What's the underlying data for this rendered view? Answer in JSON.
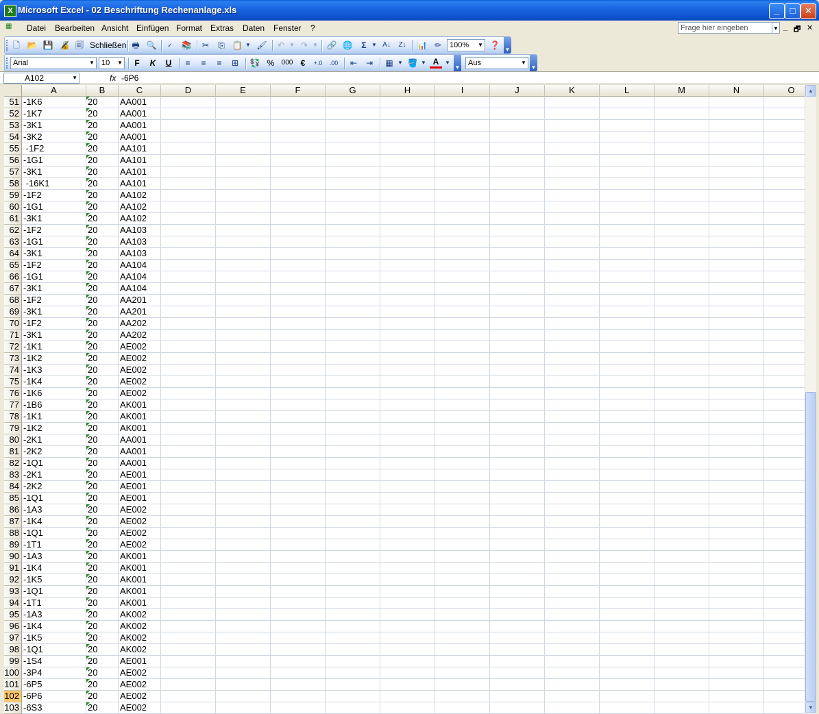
{
  "window": {
    "title": "Microsoft Excel - 02 Beschriftung Rechenanlage.xls",
    "app_icon_letter": "X",
    "minimize": "_",
    "maximize": "□",
    "close": "✕"
  },
  "menu": {
    "items": [
      "Datei",
      "Bearbeiten",
      "Ansicht",
      "Einfügen",
      "Format",
      "Extras",
      "Daten",
      "Fenster",
      "?"
    ],
    "help_placeholder": "Frage hier eingeben",
    "doc_minimize": "_",
    "doc_restore": "🗗",
    "doc_close": "✕"
  },
  "standard_toolbar": {
    "close_label": "Schließen",
    "zoom": "100%"
  },
  "format_toolbar": {
    "font": "Arial",
    "size": "10",
    "bold": "F",
    "italic": "K",
    "underline": "U",
    "percent": "%",
    "thousands": "000",
    "euro": "€",
    "style": "Aus"
  },
  "formula_bar": {
    "name_box": "A102",
    "fx": "fx",
    "value": "-6P6"
  },
  "colors": {
    "selected_row_header": "#FFC66C",
    "error_triangle": "#1F8F1F"
  },
  "sheet": {
    "columns": [
      "A",
      "B",
      "C",
      "D",
      "E",
      "F",
      "G",
      "H",
      "I",
      "J",
      "K",
      "L",
      "M",
      "N",
      "O"
    ],
    "selected_row": "102",
    "rows": [
      {
        "n": "51",
        "a": "-1K6",
        "b": "20",
        "c": "AA001"
      },
      {
        "n": "52",
        "a": "-1K7",
        "b": "20",
        "c": "AA001"
      },
      {
        "n": "53",
        "a": "-3K1",
        "b": "20",
        "c": "AA001"
      },
      {
        "n": "54",
        "a": "-3K2",
        "b": "20",
        "c": "AA001"
      },
      {
        "n": "55",
        "a": " -1F2",
        "b": "20",
        "c": "AA101"
      },
      {
        "n": "56",
        "a": "-1G1",
        "b": "20",
        "c": "AA101"
      },
      {
        "n": "57",
        "a": "-3K1",
        "b": "20",
        "c": "AA101"
      },
      {
        "n": "58",
        "a": " -16K1",
        "b": "20",
        "c": "AA101"
      },
      {
        "n": "59",
        "a": "-1F2",
        "b": "20",
        "c": "AA102"
      },
      {
        "n": "60",
        "a": "-1G1",
        "b": "20",
        "c": "AA102"
      },
      {
        "n": "61",
        "a": "-3K1",
        "b": "20",
        "c": "AA102"
      },
      {
        "n": "62",
        "a": "-1F2",
        "b": "20",
        "c": "AA103"
      },
      {
        "n": "63",
        "a": "-1G1",
        "b": "20",
        "c": "AA103"
      },
      {
        "n": "64",
        "a": "-3K1",
        "b": "20",
        "c": "AA103"
      },
      {
        "n": "65",
        "a": "-1F2",
        "b": "20",
        "c": "AA104"
      },
      {
        "n": "66",
        "a": "-1G1",
        "b": "20",
        "c": "AA104"
      },
      {
        "n": "67",
        "a": "-3K1",
        "b": "20",
        "c": "AA104"
      },
      {
        "n": "68",
        "a": "-1F2",
        "b": "20",
        "c": "AA201"
      },
      {
        "n": "69",
        "a": "-3K1",
        "b": "20",
        "c": "AA201"
      },
      {
        "n": "70",
        "a": "-1F2",
        "b": "20",
        "c": "AA202"
      },
      {
        "n": "71",
        "a": "-3K1",
        "b": "20",
        "c": "AA202"
      },
      {
        "n": "72",
        "a": "-1K1",
        "b": "20",
        "c": "AE002"
      },
      {
        "n": "73",
        "a": "-1K2",
        "b": "20",
        "c": "AE002"
      },
      {
        "n": "74",
        "a": "-1K3",
        "b": "20",
        "c": "AE002"
      },
      {
        "n": "75",
        "a": "-1K4",
        "b": "20",
        "c": "AE002"
      },
      {
        "n": "76",
        "a": "-1K6",
        "b": "20",
        "c": "AE002"
      },
      {
        "n": "77",
        "a": "-1B6",
        "b": "20",
        "c": "AK001"
      },
      {
        "n": "78",
        "a": "-1K1",
        "b": "20",
        "c": "AK001"
      },
      {
        "n": "79",
        "a": "-1K2",
        "b": "20",
        "c": "AK001"
      },
      {
        "n": "80",
        "a": "-2K1",
        "b": "20",
        "c": "AA001"
      },
      {
        "n": "81",
        "a": "-2K2",
        "b": "20",
        "c": "AA001"
      },
      {
        "n": "82",
        "a": "-1Q1",
        "b": "20",
        "c": "AA001"
      },
      {
        "n": "83",
        "a": "-2K1",
        "b": "20",
        "c": "AE001"
      },
      {
        "n": "84",
        "a": "-2K2",
        "b": "20",
        "c": "AE001"
      },
      {
        "n": "85",
        "a": "-1Q1",
        "b": "20",
        "c": "AE001"
      },
      {
        "n": "86",
        "a": "-1A3",
        "b": "20",
        "c": "AE002"
      },
      {
        "n": "87",
        "a": "-1K4",
        "b": "20",
        "c": "AE002"
      },
      {
        "n": "88",
        "a": "-1Q1",
        "b": "20",
        "c": "AE002"
      },
      {
        "n": "89",
        "a": "-1T1",
        "b": "20",
        "c": "AE002"
      },
      {
        "n": "90",
        "a": "-1A3",
        "b": "20",
        "c": "AK001"
      },
      {
        "n": "91",
        "a": "-1K4",
        "b": "20",
        "c": "AK001"
      },
      {
        "n": "92",
        "a": "-1K5",
        "b": "20",
        "c": "AK001"
      },
      {
        "n": "93",
        "a": "-1Q1",
        "b": "20",
        "c": "AK001"
      },
      {
        "n": "94",
        "a": "-1T1",
        "b": "20",
        "c": "AK001"
      },
      {
        "n": "95",
        "a": "-1A3",
        "b": "20",
        "c": "AK002"
      },
      {
        "n": "96",
        "a": "-1K4",
        "b": "20",
        "c": "AK002"
      },
      {
        "n": "97",
        "a": "-1K5",
        "b": "20",
        "c": "AK002"
      },
      {
        "n": "98",
        "a": "-1Q1",
        "b": "20",
        "c": "AK002"
      },
      {
        "n": "99",
        "a": "-1S4",
        "b": "20",
        "c": "AE001"
      },
      {
        "n": "100",
        "a": "-3P4",
        "b": "20",
        "c": "AE002"
      },
      {
        "n": "101",
        "a": "-6P5",
        "b": "20",
        "c": "AE002"
      },
      {
        "n": "102",
        "a": "-6P6",
        "b": "20",
        "c": "AE002"
      },
      {
        "n": "103",
        "a": "-6S3",
        "b": "20",
        "c": "AE002"
      }
    ]
  }
}
